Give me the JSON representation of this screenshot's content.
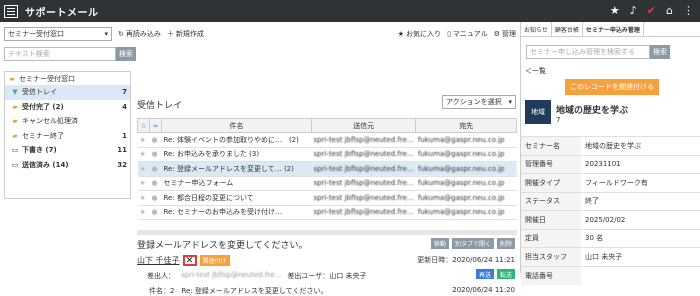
{
  "app": {
    "title": "サポートメール"
  },
  "toolbar": {
    "queue": "セミナー受付窓口",
    "reload": "再読み込み",
    "new": "新規作成",
    "favorite": "お気に入り",
    "manual": "マニュアル",
    "admin": "管理"
  },
  "search": {
    "placeholder": "テキスト検索",
    "button": "検索"
  },
  "tree": {
    "root": "セミナー受付窓口",
    "items": [
      {
        "label": "受信トレイ",
        "count": "7",
        "bold": false
      },
      {
        "label": "受付完了 (2)",
        "count": "4",
        "bold": true
      },
      {
        "label": "キャンセル処理済",
        "count": "",
        "bold": false
      },
      {
        "label": "セミナー終了",
        "count": "1",
        "bold": false
      },
      {
        "label": "下書き (7)",
        "count": "11",
        "bold": true
      },
      {
        "label": "送信済み (14)",
        "count": "32",
        "bold": true
      }
    ]
  },
  "inbox": {
    "title": "受信トレイ",
    "action": "アクションを選択",
    "columns": {
      "subject": "件名",
      "from": "送信元",
      "to": "宛先"
    },
    "rows": [
      {
        "subject": "Re: 体験イベントの参加取りやめに…　(2)",
        "from": "spri-test jbflsp@neuted.fre…",
        "to": "fukuma@gaspr.neu.co.jp"
      },
      {
        "subject": "Re: お申込みを承りました (3)",
        "from": "spri-test jbflsp@neuted.fre…",
        "to": "fukuma@gaspr.neu.co.jp"
      },
      {
        "subject": "Re: 登録メールアドレスを変更して… (2)",
        "from": "spri-test jbflsp@neuted.fre…",
        "to": "fukuma@gaspr.neu.co.jp"
      },
      {
        "subject": "セミナー申込フォーム",
        "from": "spri-test jbflsp@neuted.fre…",
        "to": "fukuma@gaspr.neu.co.jp"
      },
      {
        "subject": "Re: 都合日程の変更について",
        "from": "spri-test jbflsp@neuted.fre…",
        "to": "fukuma@gaspr.neu.co.jp"
      },
      {
        "subject": "Re: セミナーのお申込みを受け付け…",
        "from": "spri-test jbflsp@neuted.fre…",
        "to": "fukuma@gaspr.neu.co.jp"
      }
    ]
  },
  "detail": {
    "subject": "登録メールアドレスを変更してください。",
    "move": "移動",
    "split": "別タブで開く",
    "delete": "削除",
    "sender": "山下 千佳子",
    "tag": "関連付け",
    "updated": "更新日時：2020/06/24 11:21",
    "from_label": "差出人：",
    "from_value": "spri-test jbflsp@neuted.fre…",
    "user_label": "差出ユーザ：山口 未央子",
    "reply": "再送",
    "forward": "転送",
    "subj_line": "件名：2　Re: 登録メールアドレスを変更してください。",
    "date2": "2020/06/24 11:20"
  },
  "right": {
    "tabs": [
      "お知らせ",
      "顧客台帳",
      "セミナー申込み管理"
    ],
    "search_placeholder": "セミナー申し込み管理を検索する",
    "search_btn": "検索",
    "back": "一覧",
    "link_btn": "このレコードを関連付ける",
    "logo": "地域",
    "name": "地域の歴史を学ぶ",
    "num": "7",
    "fields": [
      {
        "k": "セミナー名",
        "v": "地域の歴史を学ぶ"
      },
      {
        "k": "管理番号",
        "v": "20231101"
      },
      {
        "k": "開催タイプ",
        "v": "フィールドワーク有"
      },
      {
        "k": "ステータス",
        "v": "終了"
      },
      {
        "k": "開催日",
        "v": "2025/02/02"
      },
      {
        "k": "定員",
        "v": "30 名"
      },
      {
        "k": "担当スタッフ",
        "v": "山口 未央子"
      },
      {
        "k": "電話番号",
        "v": ""
      }
    ]
  }
}
